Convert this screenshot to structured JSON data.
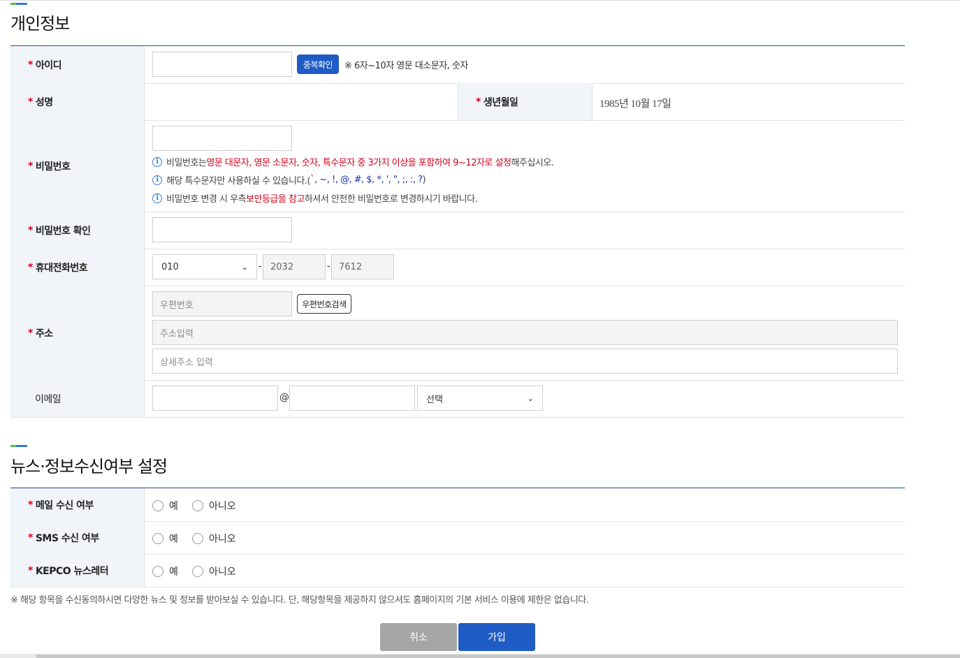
{
  "section1": {
    "title": "개인정보"
  },
  "rows": {
    "id": {
      "label": "아이디",
      "required": "*",
      "check_button": "중복확인",
      "hint": "※ 6자~10자 영문 대소문자, 숫자"
    },
    "name": {
      "label": "성명",
      "required": "*"
    },
    "birth": {
      "label": "생년월일",
      "required": "*",
      "value": "1985년 10월 17일"
    },
    "password": {
      "label": "비밀번호",
      "required": "*",
      "info1": {
        "a": "비밀번호는 ",
        "b": "영문 대문자, 영문 소문자, 숫자, 특수문자 중 3가지 이상을 포함하여 9~12자로 설정",
        "c": "해주십시오."
      },
      "info2": {
        "a": "해당 특수문자만 사용하실 수 있습니다.( ",
        "b": "`, ~, !, @, #, $, *, ', \", ;, :, ?",
        "c": ")"
      },
      "info3": {
        "a": "비밀번호 변경 시 우측 ",
        "b": "보안등급을 참고",
        "c": "하셔서 안전한 비밀번호로 변경하시기 바랍니다."
      }
    },
    "password_confirm": {
      "label": "비밀번호 확인",
      "required": "*"
    },
    "phone": {
      "label": "휴대전화번호",
      "required": "*",
      "prefix": "010",
      "middle": "2032",
      "last": "7612",
      "sep": "-"
    },
    "address": {
      "label": "주소",
      "required": "*",
      "zip_placeholder": "우편번호",
      "zip_button": "우편번호검색",
      "addr_placeholder": "주소입력",
      "detail_placeholder": "상세주소 입력"
    },
    "email": {
      "label": "이메일",
      "at": "@",
      "domain_select": "선택"
    }
  },
  "section2": {
    "title": "뉴스·정보수신여부 설정"
  },
  "consent": [
    {
      "label": "메일 수신 여부",
      "required": "*",
      "yes": "예",
      "no": "아니오"
    },
    {
      "label": "SMS 수신 여부",
      "required": "*",
      "yes": "예",
      "no": "아니오"
    },
    {
      "label": "KEPCO 뉴스레터",
      "required": "*",
      "yes": "예",
      "no": "아니오"
    }
  ],
  "footnote": "※ 해당 항목을 수신동의하시면 다양한 뉴스 및 정보를 받아보실 수 있습니다. 단, 해당항목을 제공하지 않으셔도 홈페이지의 기본 서비스 이용에 제한은 없습니다.",
  "buttons": {
    "cancel": "취소",
    "join": "가입"
  },
  "colors": {
    "primary": "#1f5bc4",
    "required": "#d0021b",
    "cancel": "#a6a6a6"
  }
}
